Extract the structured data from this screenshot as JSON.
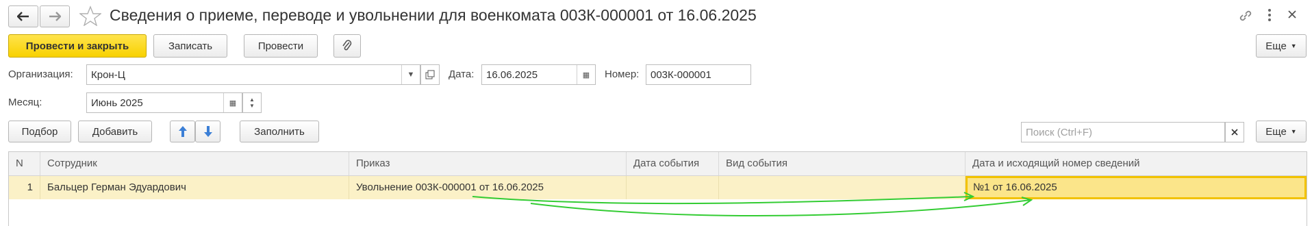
{
  "window": {
    "title": "Сведения о приеме, переводе и увольнении для военкомата 003К-000001 от 16.06.2025"
  },
  "toolbar": {
    "post_close": "Провести и закрыть",
    "save": "Записать",
    "post": "Провести",
    "more": "Еще"
  },
  "form": {
    "org_label": "Организация:",
    "org_value": "Крон-Ц",
    "date_label": "Дата:",
    "date_value": "16.06.2025",
    "number_label": "Номер:",
    "number_value": "003К-000001",
    "month_label": "Месяц:",
    "month_value": "Июнь 2025"
  },
  "table_toolbar": {
    "pick": "Подбор",
    "add": "Добавить",
    "fill": "Заполнить",
    "search_placeholder": "Поиск (Ctrl+F)",
    "more": "Еще"
  },
  "table": {
    "columns": [
      "N",
      "Сотрудник",
      "Приказ",
      "Дата события",
      "Вид события",
      "Дата и исходящий номер сведений"
    ],
    "rows": [
      {
        "n": "1",
        "employee": "Бальцер Герман Эдуардович",
        "order": "Увольнение 003К-000001 от 16.06.2025",
        "event_date": "",
        "event_type": "",
        "info": "№1 от 16.06.2025"
      }
    ]
  },
  "colors": {
    "primary": "#f8d100",
    "row_highlight": "#fbf1c7",
    "annotation": "#33cc33"
  }
}
